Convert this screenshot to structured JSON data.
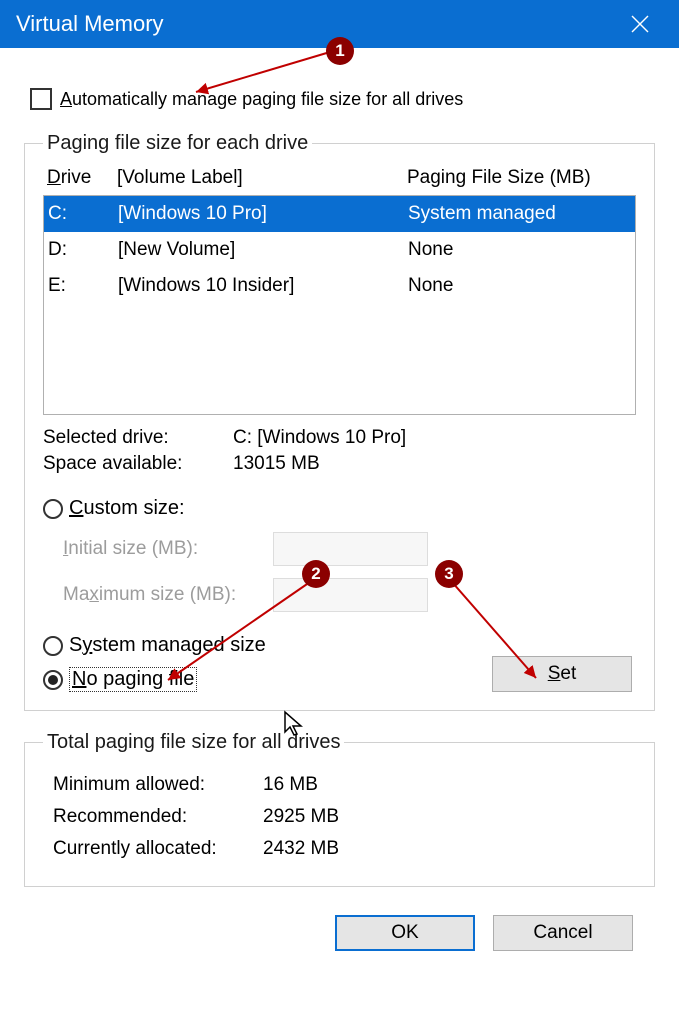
{
  "title": "Virtual Memory",
  "auto_manage_label": "Automatically manage paging file size for all drives",
  "auto_manage_checked": false,
  "group1_legend": "Paging file size for each drive",
  "cols": {
    "drive": "Drive",
    "volume": "[Volume Label]",
    "pfs": "Paging File Size (MB)"
  },
  "drives": [
    {
      "letter": "C:",
      "label": "[Windows 10 Pro]",
      "pfs": "System managed",
      "selected": true
    },
    {
      "letter": "D:",
      "label": "[New Volume]",
      "pfs": "None",
      "selected": false
    },
    {
      "letter": "E:",
      "label": "[Windows 10 Insider]",
      "pfs": "None",
      "selected": false
    }
  ],
  "selected_drive_lab": "Selected drive:",
  "selected_drive_val": "C:  [Windows 10 Pro]",
  "space_lab": "Space available:",
  "space_val": "13015 MB",
  "radio_custom": "Custom size:",
  "initial_lab": "Initial size (MB):",
  "maximum_lab": "Maximum size (MB):",
  "radio_system": "System managed size",
  "radio_none": "No paging file",
  "btn_set": "Set",
  "group2_legend": "Total paging file size for all drives",
  "min_lab": "Minimum allowed:",
  "min_val": "16 MB",
  "rec_lab": "Recommended:",
  "rec_val": "2925 MB",
  "cur_lab": "Currently allocated:",
  "cur_val": "2432 MB",
  "btn_ok": "OK",
  "btn_cancel": "Cancel",
  "markers": {
    "m1": "1",
    "m2": "2",
    "m3": "3"
  }
}
